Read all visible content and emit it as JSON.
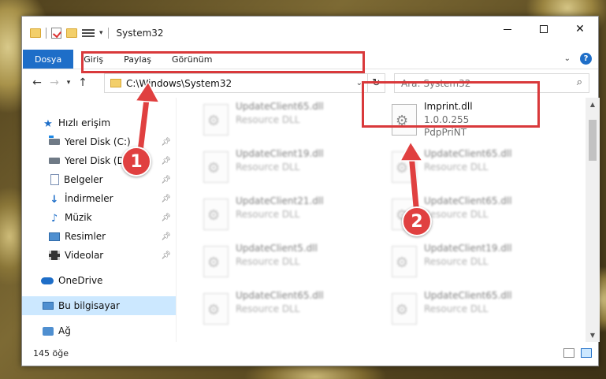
{
  "window": {
    "title": "System32"
  },
  "ribbon": {
    "tabs": [
      "Dosya",
      "Giriş",
      "Paylaş",
      "Görünüm"
    ],
    "help_label": "?"
  },
  "address": {
    "path": "C:\\Windows\\System32"
  },
  "search": {
    "placeholder": "Ara: System32"
  },
  "nav": {
    "items": [
      {
        "label": "Hızlı erişim",
        "icon": "star-icon",
        "pinned": false
      },
      {
        "label": "Yerel Disk (C:)",
        "icon": "disk-icon",
        "pinned": true
      },
      {
        "label": "Yerel Disk (D:)",
        "icon": "disk-icon",
        "pinned": true
      },
      {
        "label": "Belgeler",
        "icon": "document-icon",
        "pinned": true
      },
      {
        "label": "İndirmeler",
        "icon": "download-icon",
        "pinned": true
      },
      {
        "label": "Müzik",
        "icon": "music-icon",
        "pinned": true
      },
      {
        "label": "Resimler",
        "icon": "pictures-icon",
        "pinned": true
      },
      {
        "label": "Videolar",
        "icon": "videos-icon",
        "pinned": true
      },
      {
        "label": "OneDrive",
        "icon": "cloud-icon",
        "pinned": false
      },
      {
        "label": "Bu bilgisayar",
        "icon": "computer-icon",
        "pinned": false,
        "selected": true
      },
      {
        "label": "Ağ",
        "icon": "network-icon",
        "pinned": false
      }
    ]
  },
  "files": {
    "highlighted": {
      "name": "Imprint.dll",
      "version": "1.0.0.255",
      "company": "PdpPriNT"
    },
    "left_column": [
      {
        "name": "UpdateClient65.dll",
        "desc": "Resource DLL"
      },
      {
        "name": "UpdateClient19.dll",
        "desc": "Resource DLL"
      },
      {
        "name": "UpdateClient21.dll",
        "desc": "Resource DLL"
      },
      {
        "name": "UpdateClient5.dll",
        "desc": "Resource DLL"
      },
      {
        "name": "UpdateClient65.dll",
        "desc": "Resource DLL"
      }
    ],
    "right_column": [
      {
        "name": "UpdateClient65.dll",
        "desc": "Resource DLL"
      },
      {
        "name": "UpdateClient65.dll",
        "desc": "Resource DLL"
      },
      {
        "name": "UpdateClient19.dll",
        "desc": "Resource DLL"
      },
      {
        "name": "UpdateClient65.dll",
        "desc": "Resource DLL"
      }
    ]
  },
  "status": {
    "item_count": "145 öğe"
  },
  "annotations": {
    "marker1": "1",
    "marker2": "2",
    "highlight_color": "#d9393b"
  }
}
